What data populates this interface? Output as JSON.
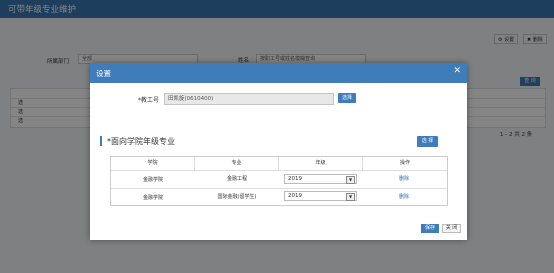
{
  "background": {
    "title": "可带年级专业维护",
    "settings_btn": "设置",
    "delete_btn": "删除",
    "dept_label": "所属部门",
    "dept_value": "全部",
    "name_label": "姓名",
    "name_placeholder": "按职工号或姓名模糊查询",
    "search_btn": "查 询",
    "rows": [
      "选",
      "选",
      "选"
    ],
    "pager": "1 - 2  共 2 条"
  },
  "modal": {
    "title": "设置",
    "employee_label": "*教工号",
    "employee_value": "田凯旋(0610400)",
    "choose_btn": "选择",
    "section_title": "*面向学院年级专业",
    "section_choose_btn": "选 择",
    "columns": [
      "学院",
      "专业",
      "年级",
      "操作"
    ],
    "rows": [
      {
        "college": "金融学院",
        "major": "金融工程",
        "grade": "2019",
        "op": "删除"
      },
      {
        "college": "金融学院",
        "major": "国际金融(留学生)",
        "grade": "2019",
        "op": "删除"
      }
    ],
    "save_btn": "保存",
    "close_btn": "关 闭"
  },
  "colors": {
    "primary": "#3f7cba",
    "overlay": "rgba(0,0,0,0.48)"
  }
}
